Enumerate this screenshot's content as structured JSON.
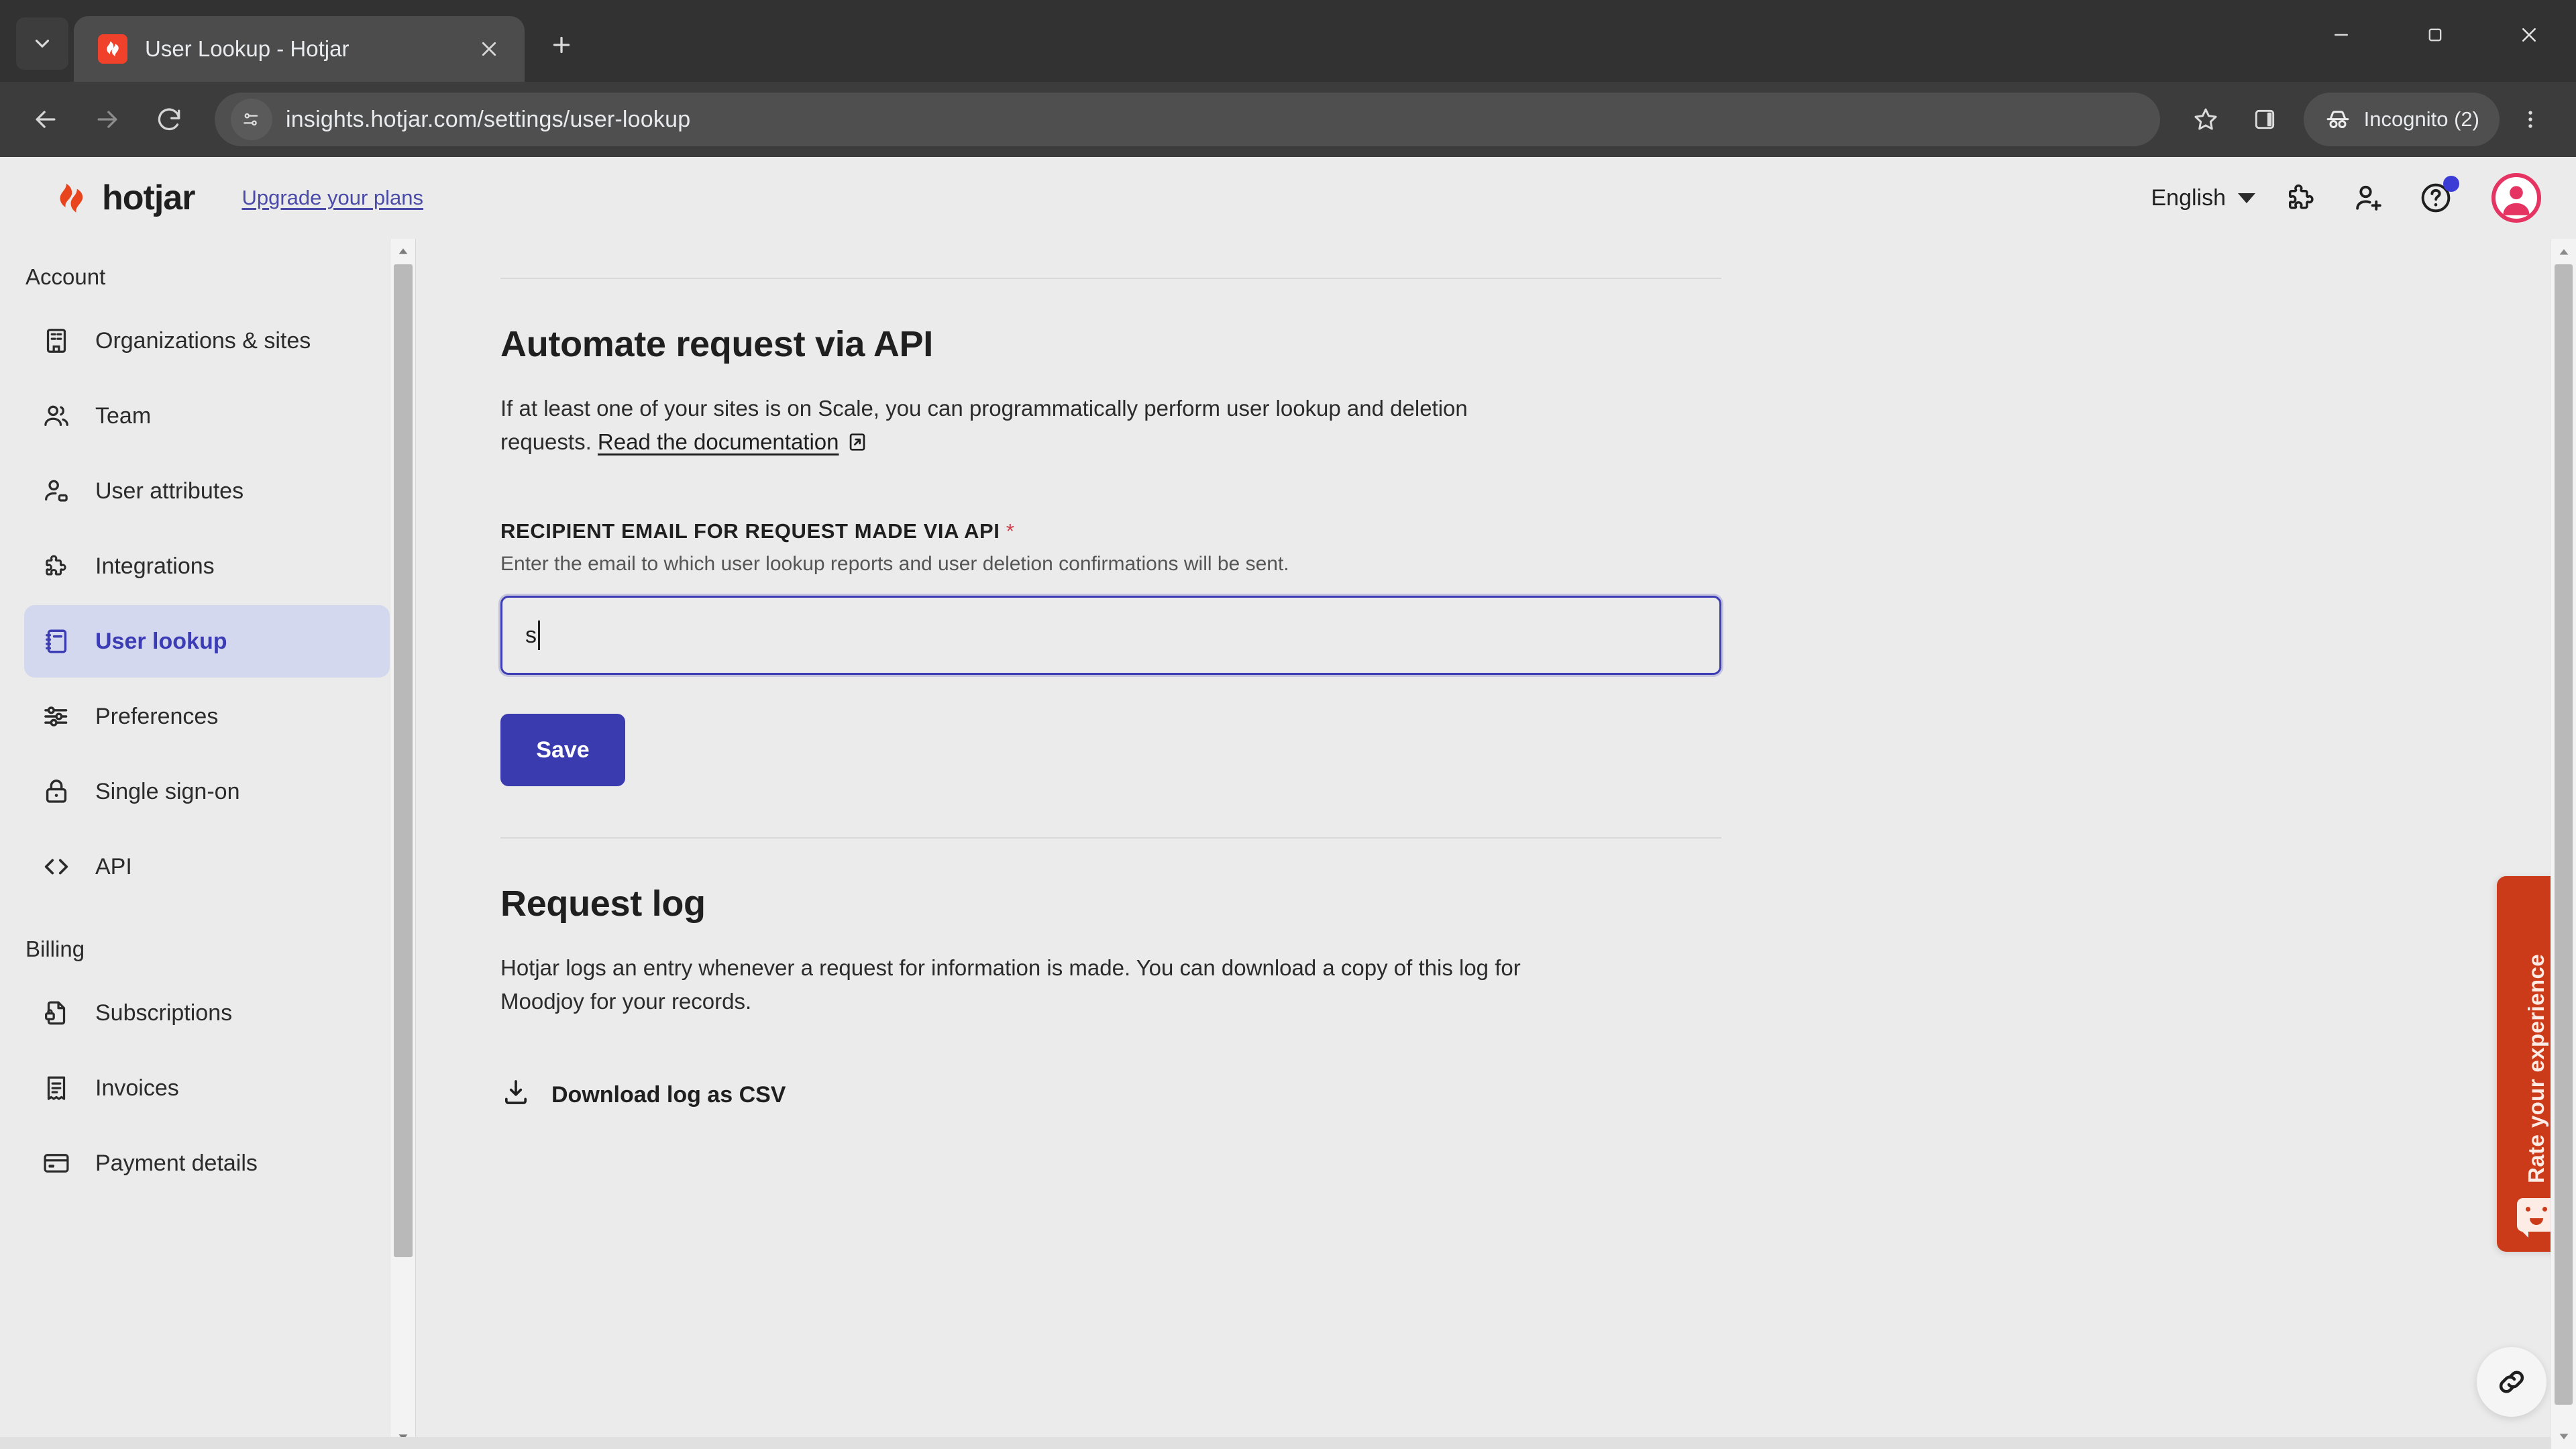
{
  "browser": {
    "tab": {
      "title": "User Lookup - Hotjar",
      "favicon": "hotjar-favicon"
    },
    "new_tab_label": "+",
    "url": "insights.hotjar.com/settings/user-lookup",
    "profile_label": "Incognito (2)",
    "icons": {
      "tab_search": "chevron-down-icon",
      "close": "close-icon",
      "back": "back-arrow-icon",
      "forward": "forward-arrow-icon",
      "reload": "reload-icon",
      "site_info": "page-settings-icon",
      "bookmark": "star-icon",
      "side_panel": "side-panel-icon",
      "incognito": "incognito-icon",
      "menu": "three-dot-menu-icon",
      "minimize": "minimize-icon",
      "maximize": "maximize-icon",
      "window_close": "window-close-icon"
    }
  },
  "app_header": {
    "logo_text": "hotjar",
    "upgrade_link": "Upgrade your plans",
    "language": "English",
    "icons": {
      "extensions": "puzzle-piece-icon",
      "invite": "add-user-icon",
      "help": "help-circle-icon",
      "avatar": "user-avatar-icon"
    }
  },
  "sidebar": {
    "groups": [
      {
        "label": "Account",
        "items": [
          {
            "label": "Organizations & sites",
            "icon": "building-icon",
            "active": false
          },
          {
            "label": "Team",
            "icon": "people-icon",
            "active": false
          },
          {
            "label": "User attributes",
            "icon": "user-tag-icon",
            "active": false
          },
          {
            "label": "Integrations",
            "icon": "puzzle-piece-icon",
            "active": false
          },
          {
            "label": "User lookup",
            "icon": "notebook-icon",
            "active": true
          },
          {
            "label": "Preferences",
            "icon": "sliders-icon",
            "active": false
          },
          {
            "label": "Single sign-on",
            "icon": "lock-icon",
            "active": false
          },
          {
            "label": "API",
            "icon": "code-brackets-icon",
            "active": false
          }
        ]
      },
      {
        "label": "Billing",
        "items": [
          {
            "label": "Subscriptions",
            "icon": "document-lock-icon",
            "active": false
          },
          {
            "label": "Invoices",
            "icon": "receipt-icon",
            "active": false
          },
          {
            "label": "Payment details",
            "icon": "credit-card-icon",
            "active": false
          }
        ]
      }
    ]
  },
  "main": {
    "api_section": {
      "title": "Automate request via API",
      "body_before_link": "If at least one of your sites is on Scale, you can programmatically perform user lookup and deletion requests. ",
      "link_text": "Read the documentation",
      "link_icon": "external-link-icon"
    },
    "email_field": {
      "label": "RECIPIENT EMAIL FOR REQUEST MADE VIA API",
      "required_marker": "*",
      "help": "Enter the email to which user lookup reports and user deletion confirmations will be sent.",
      "value": "s",
      "placeholder": ""
    },
    "save_button": "Save",
    "request_log": {
      "title": "Request log",
      "body": "Hotjar logs an entry whenever a request for information is made. You can download a copy of this log for Moodjoy for your records.",
      "download_label": "Download log as CSV",
      "download_icon": "download-icon"
    }
  },
  "widgets": {
    "rate_tab_label": "Rate your experience",
    "rate_tab_icon": "smiley-speech-icon",
    "rate_tab_color": "#cc3b19",
    "link_fab_icon": "link-icon"
  },
  "colors": {
    "accent": "#3b3bb0",
    "brand": "#f0422a",
    "active_nav_bg": "#d3d8ef",
    "active_nav_text": "#3c3cb4"
  }
}
